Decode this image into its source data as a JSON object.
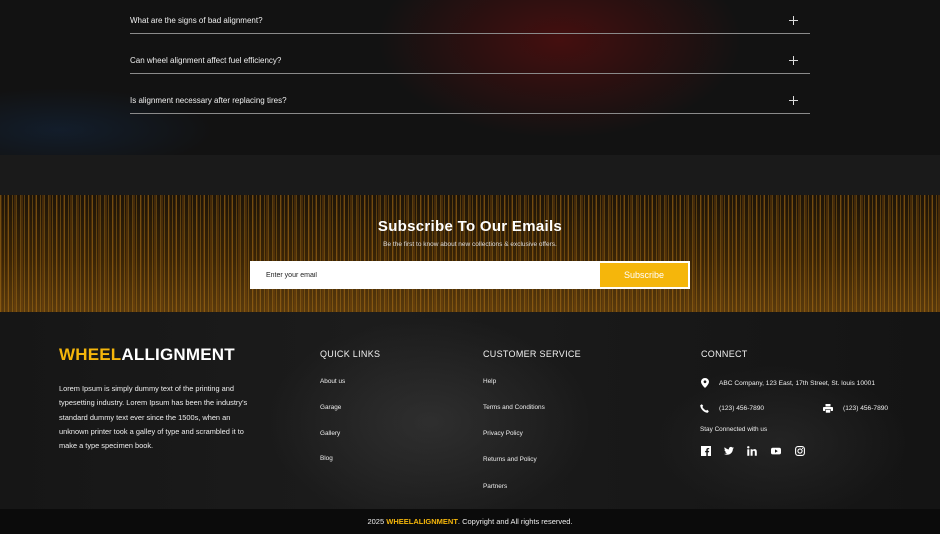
{
  "faq": {
    "items": [
      {
        "question": "What are the signs of bad alignment?"
      },
      {
        "question": "Can wheel alignment affect fuel efficiency?"
      },
      {
        "question": "Is alignment necessary after replacing tires?"
      }
    ]
  },
  "subscribe": {
    "title": "Subscribe To Our Emails",
    "subtitle": "Be the first to know about new collections & exclusive offers.",
    "input_placeholder": "Enter your email",
    "button_label": "Subscribe"
  },
  "footer": {
    "logo": {
      "part1": "WHEEL",
      "part2": "ALLIGNMENT"
    },
    "about": "Lorem Ipsum is simply dummy text of the printing and typesetting industry. Lorem Ipsum has been the industry's standard dummy text ever since the 1500s, when an unknown printer took a galley of type and scrambled it to make a type specimen book.",
    "quick_links": {
      "title": "QUICK LINKS",
      "items": [
        "About us",
        "Garage",
        "Gallery",
        "Blog"
      ]
    },
    "customer_service": {
      "title": "CUSTOMER SERVICE",
      "items": [
        "Help",
        "Terms and Conditions",
        "Privacy Policy",
        "Returns and Policy",
        "Partners"
      ]
    },
    "connect": {
      "title": "CONNECT",
      "address": "ABC Company, 123 East, 17th Street, St. louis 10001",
      "phone": "(123) 456-7890",
      "fax": "(123) 456-7890",
      "stay_connected": "Stay Connected with us",
      "social_icons": [
        "facebook-icon",
        "twitter-icon",
        "linkedin-icon",
        "youtube-icon",
        "instagram-icon"
      ]
    }
  },
  "copyright": {
    "prefix": "2025",
    "brand": "WHEELALIGNMENT",
    "suffix": ". Copyright and All rights reserved."
  },
  "colors": {
    "accent": "#f5b60b",
    "background": "#121212"
  }
}
